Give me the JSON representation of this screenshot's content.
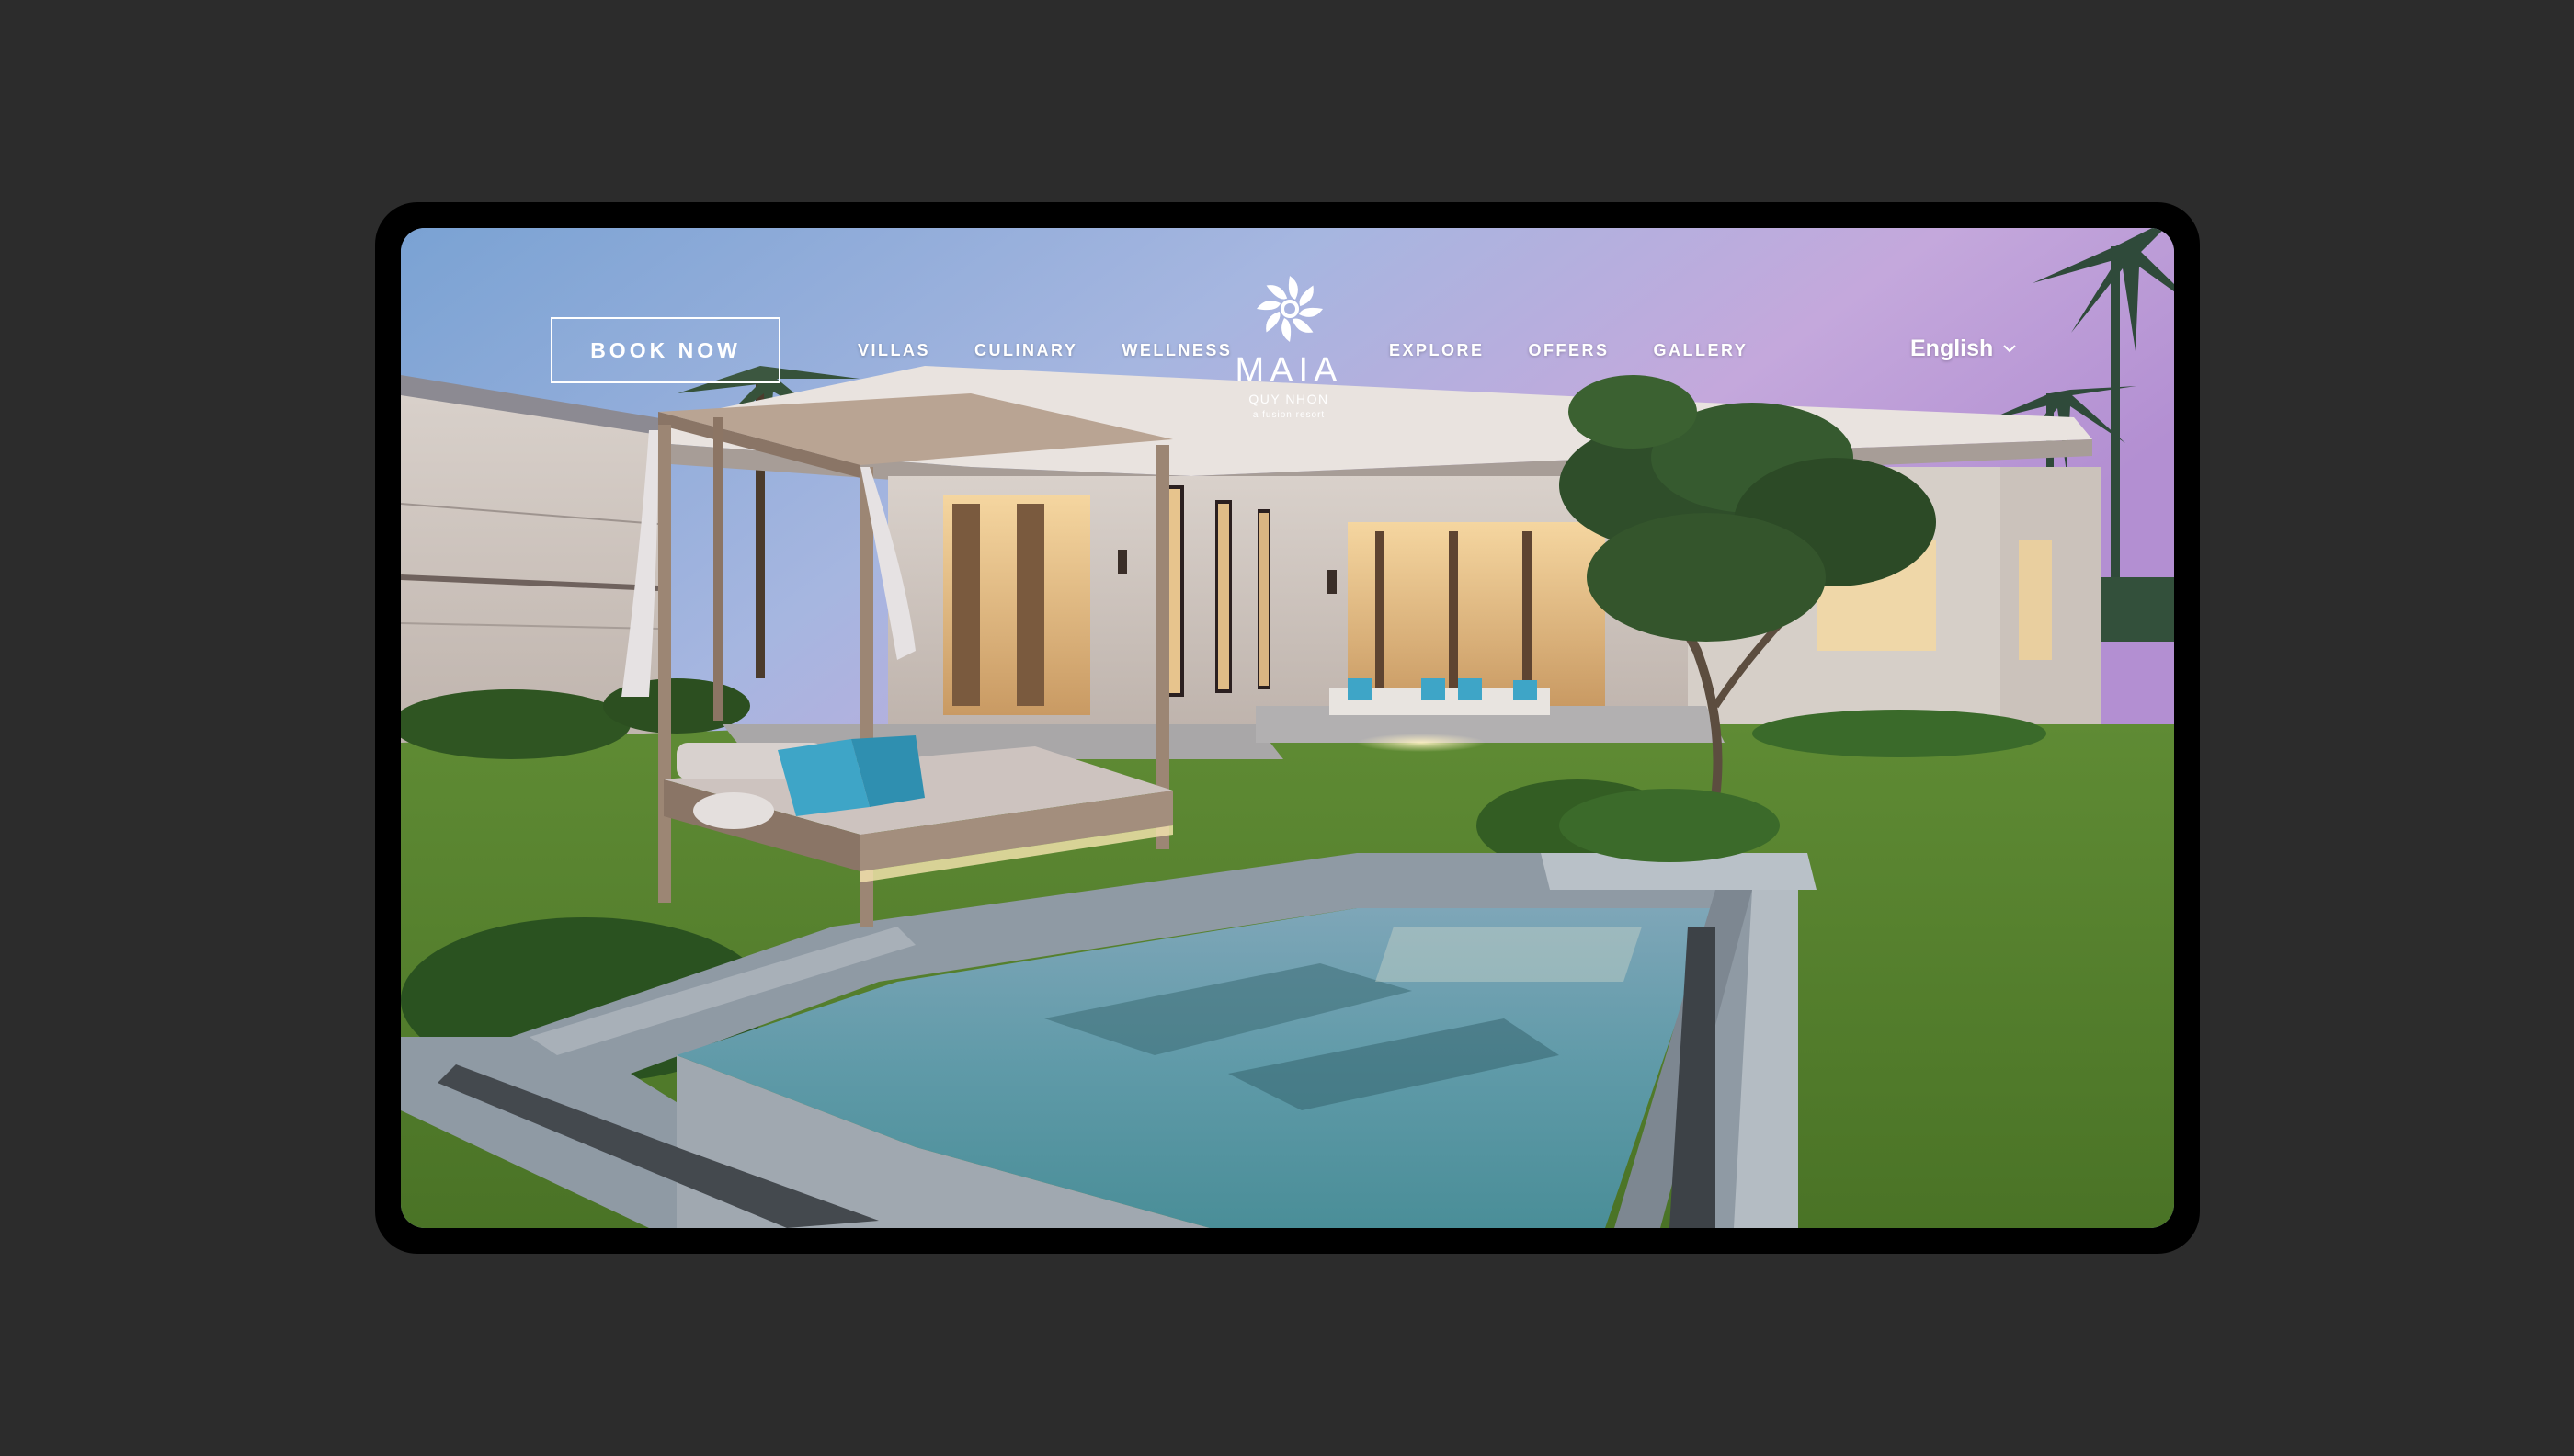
{
  "header": {
    "book_label": "BOOK NOW",
    "nav_left": [
      "VILLAS",
      "CULINARY",
      "WELLNESS"
    ],
    "nav_right": [
      "EXPLORE",
      "OFFERS",
      "GALLERY"
    ],
    "language": "English",
    "language_icon": "chevron-down-icon"
  },
  "logo": {
    "name": "MAIA",
    "subtitle": "QUY NHON",
    "tagline": "a fusion resort",
    "icon": "flower-icon"
  },
  "hero": {
    "image_icon": "villa-photo"
  },
  "colors": {
    "background": "#2c2c2c",
    "frame": "#000000",
    "text": "#ffffff"
  }
}
